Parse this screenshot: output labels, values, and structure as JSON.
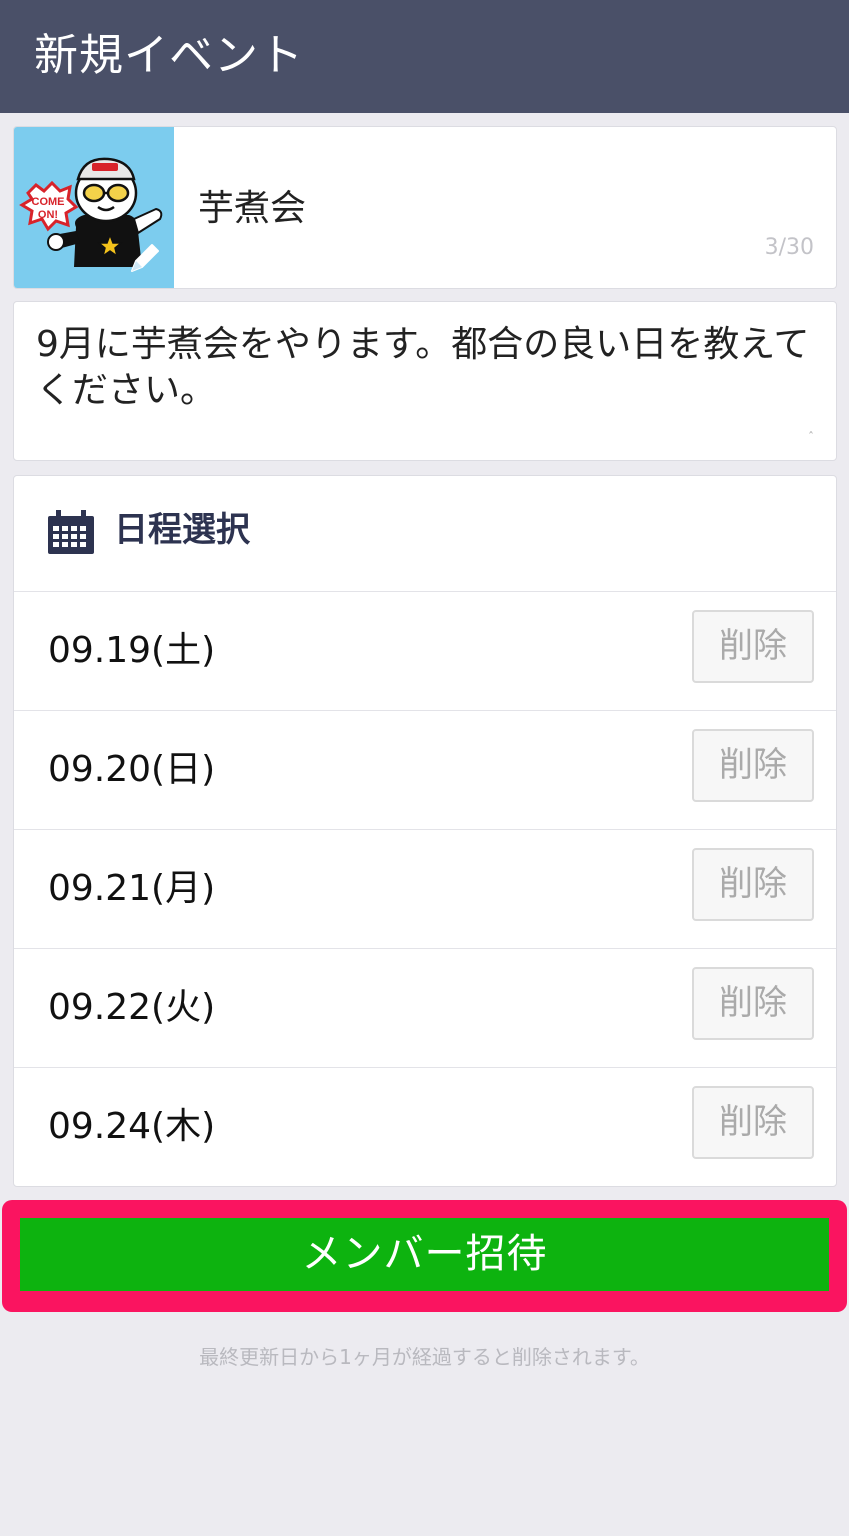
{
  "header": {
    "title": "新規イベント"
  },
  "event": {
    "title": "芋煮会",
    "title_counter": "3/30",
    "sticker_text": "COME ON!",
    "description": "9月に芋煮会をやります。都合の良い日を教えてください。"
  },
  "schedule": {
    "heading": "日程選択",
    "dates": [
      {
        "label": "09.19(土)",
        "delete_label": "削除"
      },
      {
        "label": "09.20(日)",
        "delete_label": "削除"
      },
      {
        "label": "09.21(月)",
        "delete_label": "削除"
      },
      {
        "label": "09.22(火)",
        "delete_label": "削除"
      },
      {
        "label": "09.24(木)",
        "delete_label": "削除"
      }
    ]
  },
  "invite": {
    "label": "メンバー招待"
  },
  "footnote": "最終更新日から1ヶ月が経過すると削除されます。",
  "colors": {
    "header_bg": "#4a5068",
    "invite_green": "#0db30f",
    "highlight_pink": "#fa1460",
    "sticker_bg": "#7cccee"
  }
}
